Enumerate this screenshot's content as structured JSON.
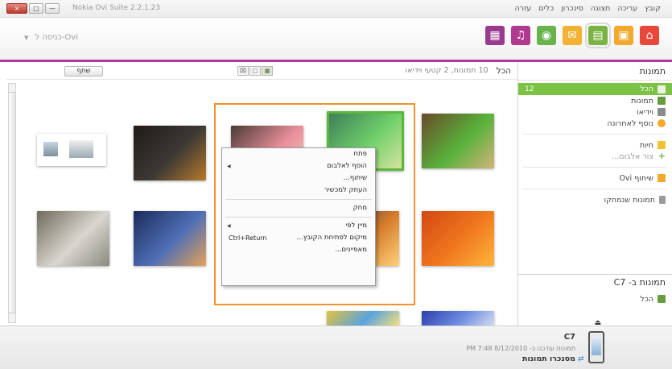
{
  "window": {
    "title": "Nokia Ovi Suite 2.2.1.23",
    "buttons": [
      "×",
      "□",
      "—"
    ]
  },
  "menu": [
    "קובץ",
    "עריכה",
    "תצוגה",
    "סינכרון",
    "כלים",
    "עזרה"
  ],
  "toolbar": {
    "signin_label": "כניסה ל-Ovi",
    "signin_arrow": "▼",
    "nav_icons": [
      {
        "name": "home-icon",
        "glyph": "⌂",
        "color": "#e8483a"
      },
      {
        "name": "contacts-icon",
        "glyph": "▣",
        "color": "#f2a92c"
      },
      {
        "name": "photos-icon",
        "glyph": "▤",
        "color": "#7ab342"
      },
      {
        "name": "messages-icon",
        "glyph": "✉",
        "color": "#f2b233"
      },
      {
        "name": "maps-icon",
        "glyph": "◉",
        "color": "#68b34a"
      },
      {
        "name": "music-icon",
        "glyph": "♫",
        "color": "#b1398f"
      },
      {
        "name": "apps-icon",
        "glyph": "▦",
        "color": "#9a3a8e"
      }
    ],
    "accent": "#b2399c"
  },
  "sidebar": {
    "header": "תמונות",
    "items": [
      {
        "label": "הכל",
        "count": "12",
        "icon_color": "#7cc245"
      },
      {
        "label": "תמונות",
        "icon_color": "#6a9b3e"
      },
      {
        "label": "וידיאו",
        "icon_color": "#8a8a8a"
      },
      {
        "label": "נוסף לאחרונה",
        "icon_color": "#f2a92c"
      }
    ],
    "albums": [
      {
        "label": "חיות",
        "icon_color": "#f2c232"
      },
      {
        "label": "צור אלבום...",
        "icon_color": "#6fb33e",
        "glyph": "+"
      }
    ],
    "share": {
      "label": "שיתוף Ovi",
      "icon_color": "#f2a92c"
    },
    "deleted": {
      "label": "תמונות שנמחקו",
      "icon_color": "#9b9b9b"
    },
    "device_header": "תמונות ב- C7",
    "device_items": [
      {
        "label": "הכל",
        "icon_color": "#6a9b3e"
      }
    ]
  },
  "content_header": {
    "share_button": "שתף",
    "path_all": "הכל",
    "path_summary": "10 תמונות, 2 קטעי וידיאו",
    "view_buttons": [
      "⌧",
      "□",
      "▦"
    ]
  },
  "photos": [
    {
      "name": "photo-parrot",
      "colors": [
        "#6a4a2a",
        "#58b23a",
        "#d2b37a"
      ]
    },
    {
      "name": "photo-frog",
      "colors": [
        "#3f7f5a",
        "#6fd06a",
        "#d6e3a0"
      ]
    },
    {
      "name": "photo-hands",
      "colors": [
        "#4a3b34",
        "#e98e9a",
        "#f4d0c0"
      ]
    },
    {
      "name": "photo-laptop",
      "colors": [
        "#1e1a16",
        "#3d3a35",
        "#b87a2a"
      ]
    },
    {
      "name": "photo-screenshot",
      "colors": [
        "#ffffff",
        "#e9eef2",
        "#3a3a3a"
      ]
    },
    {
      "name": "photo-flower",
      "colors": [
        "#d44712",
        "#f07a1f",
        "#ffb43c"
      ]
    },
    {
      "name": "photo-desert",
      "colors": [
        "#2a2a5a",
        "#d47a2a",
        "#ffd27a"
      ]
    },
    {
      "name": "photo-lighthouse",
      "colors": [
        "#1c2a5a",
        "#4f6fb5",
        "#e6a25a"
      ]
    },
    {
      "name": "photo-koala",
      "colors": [
        "#6f6a5a",
        "#d9d6cf",
        "#8a8a80"
      ]
    },
    {
      "name": "photo-jellyfish",
      "colors": [
        "#2a3fae",
        "#6f8ce0",
        "#d3dcf0"
      ]
    },
    {
      "name": "photo-tulips",
      "colors": [
        "#e3c23a",
        "#5aa3e0",
        "#f5e07a"
      ]
    }
  ],
  "context_menu": {
    "items": [
      {
        "label": "פתח"
      },
      {
        "label": "הוסף לאלבום",
        "submenu": true
      },
      {
        "label": "שיתוף..."
      },
      {
        "label": "העתק למכשיר"
      },
      {
        "sep": true
      },
      {
        "label": "מחק"
      },
      {
        "sep": true
      },
      {
        "label": "מיין לפי",
        "submenu": true
      },
      {
        "label": "מיקום לפתיחת הקובץ...",
        "shortcut": "Ctrl+Return"
      },
      {
        "label": "מאפיינים..."
      }
    ],
    "submenu_arrow": "◀"
  },
  "device": {
    "name": "C7",
    "sync_text": "תמונות עודכנו ב- 8/12/2010 7:48 PM",
    "sync_button": "מסנכרו תמונות",
    "eject_glyph": "⏏",
    "sync_glyph": "⇄"
  }
}
